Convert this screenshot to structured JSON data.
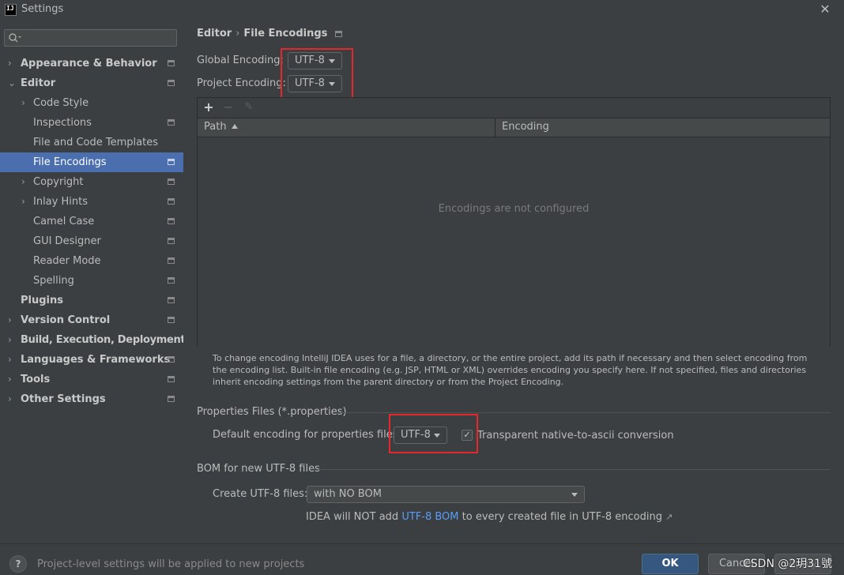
{
  "window": {
    "title": "Settings",
    "app_icon_text": "IJ"
  },
  "sidebar": {
    "search_placeholder": "",
    "items": [
      {
        "label": "Appearance & Behavior"
      },
      {
        "label": "Editor"
      },
      {
        "label": "Code Style"
      },
      {
        "label": "Inspections"
      },
      {
        "label": "File and Code Templates"
      },
      {
        "label": "File Encodings"
      },
      {
        "label": "Copyright"
      },
      {
        "label": "Inlay Hints"
      },
      {
        "label": "Camel Case"
      },
      {
        "label": "GUI Designer"
      },
      {
        "label": "Reader Mode"
      },
      {
        "label": "Spelling"
      },
      {
        "label": "Plugins"
      },
      {
        "label": "Version Control"
      },
      {
        "label": "Build, Execution, Deployment"
      },
      {
        "label": "Languages & Frameworks"
      },
      {
        "label": "Tools"
      },
      {
        "label": "Other Settings"
      }
    ]
  },
  "breadcrumb": {
    "parent": "Editor",
    "separator": "›",
    "current": "File Encodings"
  },
  "encodings": {
    "global_label": "Global Encoding:",
    "global_value": "UTF-8",
    "project_label": "Project Encoding:",
    "project_value": "UTF-8"
  },
  "table": {
    "toolbar": {
      "add": "+",
      "remove": "−",
      "edit": "✎"
    },
    "columns": [
      "Path",
      "Encoding"
    ],
    "empty_text": "Encodings are not configured"
  },
  "help_text": "To change encoding IntelliJ IDEA uses for a file, a directory, or the entire project, add its path if necessary and then select encoding from the encoding list. Built-in file encoding (e.g. JSP, HTML or XML) overrides encoding you specify here. If not specified, files and directories inherit encoding settings from the parent directory or from the Project Encoding.",
  "properties": {
    "section_title": "Properties Files (*.properties)",
    "default_label": "Default encoding for properties files:",
    "default_value": "UTF-8",
    "checkbox_checked": true,
    "checkbox_label": "Transparent native-to-ascii conversion"
  },
  "bom": {
    "section_title": "BOM for new UTF-8 files",
    "create_label": "Create UTF-8 files:",
    "create_value": "with NO BOM",
    "note_prefix": "IDEA will NOT add ",
    "note_link": "UTF-8 BOM",
    "note_suffix": " to every created file in UTF-8 encoding",
    "note_icon": "↗"
  },
  "footer": {
    "help": "?",
    "note": "Project-level settings will be applied to new projects",
    "ok": "OK",
    "cancel": "Cancel",
    "apply": "Apply",
    "watermark": "CSDN @2玥31號"
  },
  "colors": {
    "selection": "#4b6eaf",
    "highlight_box": "#e4282b",
    "link": "#589df6",
    "ok_button": "#365880"
  }
}
